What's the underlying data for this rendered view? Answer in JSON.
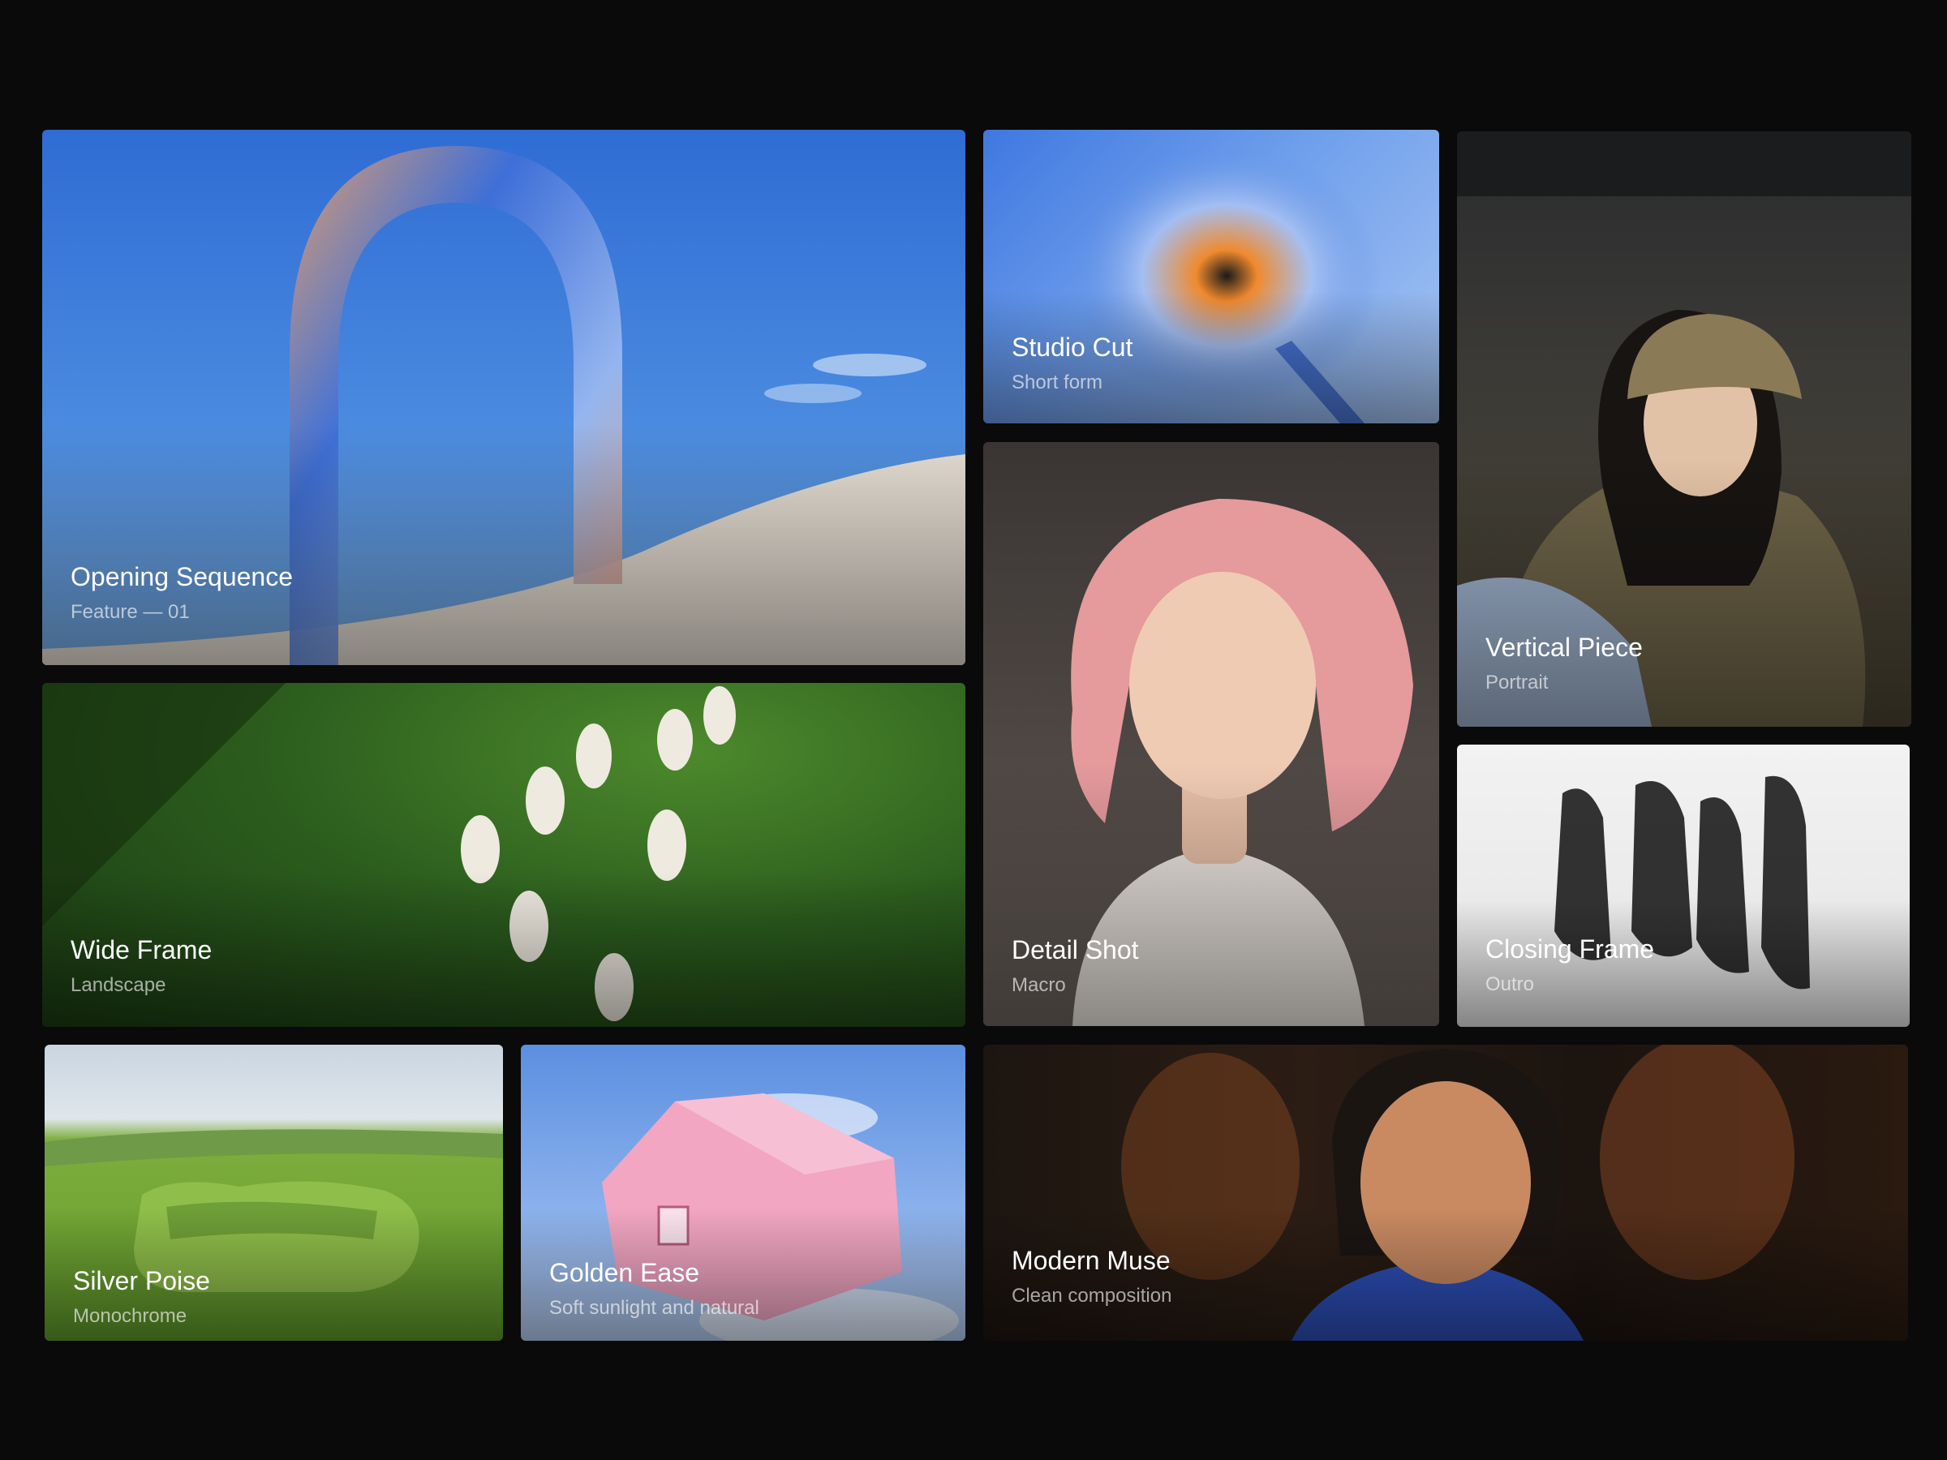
{
  "gallery": {
    "tiles": [
      {
        "title": "Opening Sequence",
        "subtitle": "Feature — 01"
      },
      {
        "title": "Wide Frame",
        "subtitle": "Landscape"
      },
      {
        "title": "Studio Cut",
        "subtitle": "Short form"
      },
      {
        "title": "Detail Shot",
        "subtitle": "Macro"
      },
      {
        "title": "Vertical Piece",
        "subtitle": "Portrait"
      },
      {
        "title": "Closing Frame",
        "subtitle": "Outro"
      },
      {
        "title": "Silver Poise",
        "subtitle": "Monochrome"
      },
      {
        "title": "Golden Ease",
        "subtitle": "Soft sunlight and natural"
      },
      {
        "title": "Modern Muse",
        "subtitle": "Clean composition"
      }
    ]
  },
  "colors": {
    "background": "#0a0a0a",
    "caption_title": "#ffffff",
    "caption_subtitle": "rgba(255,255,255,0.62)"
  }
}
